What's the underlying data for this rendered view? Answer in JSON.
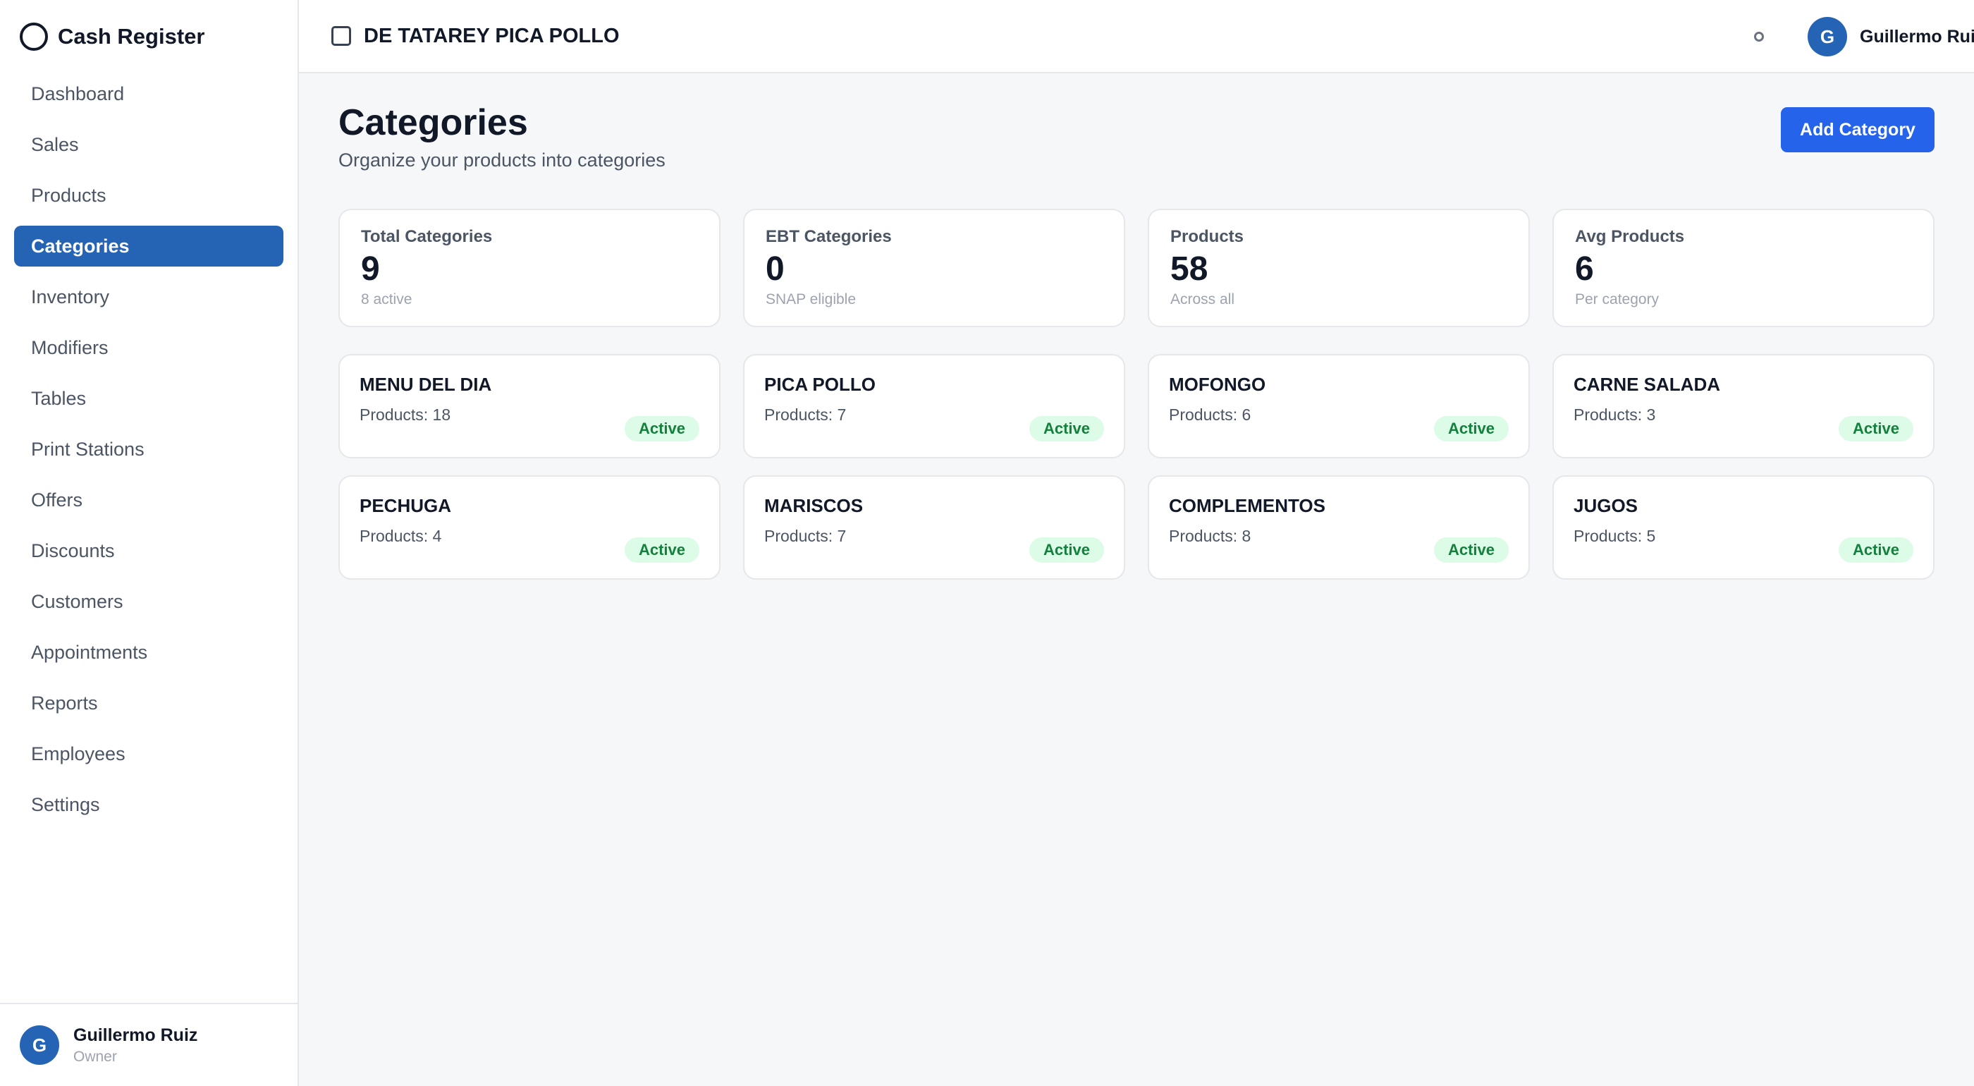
{
  "app": {
    "title": "Cash Register"
  },
  "sidebar": {
    "items": [
      {
        "label": "Dashboard"
      },
      {
        "label": "Sales"
      },
      {
        "label": "Products"
      },
      {
        "label": "Categories"
      },
      {
        "label": "Inventory"
      },
      {
        "label": "Modifiers"
      },
      {
        "label": "Tables"
      },
      {
        "label": "Print Stations"
      },
      {
        "label": "Offers"
      },
      {
        "label": "Discounts"
      },
      {
        "label": "Customers"
      },
      {
        "label": "Appointments"
      },
      {
        "label": "Reports"
      },
      {
        "label": "Employees"
      },
      {
        "label": "Settings"
      }
    ],
    "active": "Categories",
    "user": {
      "initial": "G",
      "name": "Guillermo Ruiz",
      "role": "Owner"
    }
  },
  "topbar": {
    "store_name": "DE TATAREY PICA POLLO",
    "user": {
      "initial": "G",
      "name": "Guillermo Ruiz"
    }
  },
  "page": {
    "title": "Categories",
    "subtitle": "Organize your products into categories",
    "add_button": "Add Category"
  },
  "stats": [
    {
      "label": "Total Categories",
      "value": "9",
      "sub": "8 active"
    },
    {
      "label": "EBT Categories",
      "value": "0",
      "sub": "SNAP eligible"
    },
    {
      "label": "Products",
      "value": "58",
      "sub": "Across all"
    },
    {
      "label": "Avg Products",
      "value": "6",
      "sub": "Per category"
    }
  ],
  "categories": [
    {
      "name": "MENU DEL DIA",
      "count": "Products: 18",
      "status": "Active"
    },
    {
      "name": "PICA POLLO",
      "count": "Products: 7",
      "status": "Active"
    },
    {
      "name": "MOFONGO",
      "count": "Products: 6",
      "status": "Active"
    },
    {
      "name": "CARNE SALADA",
      "count": "Products: 3",
      "status": "Active"
    },
    {
      "name": "PECHUGA",
      "count": "Products: 4",
      "status": "Active"
    },
    {
      "name": "MARISCOS",
      "count": "Products: 7",
      "status": "Active"
    },
    {
      "name": "COMPLEMENTOS",
      "count": "Products: 8",
      "status": "Active"
    },
    {
      "name": "JUGOS",
      "count": "Products: 5",
      "status": "Active"
    }
  ],
  "colors": {
    "primary": "#2563eb",
    "nav_active": "#2563b4",
    "badge_bg": "#dcfce7",
    "badge_text": "#15803d"
  }
}
